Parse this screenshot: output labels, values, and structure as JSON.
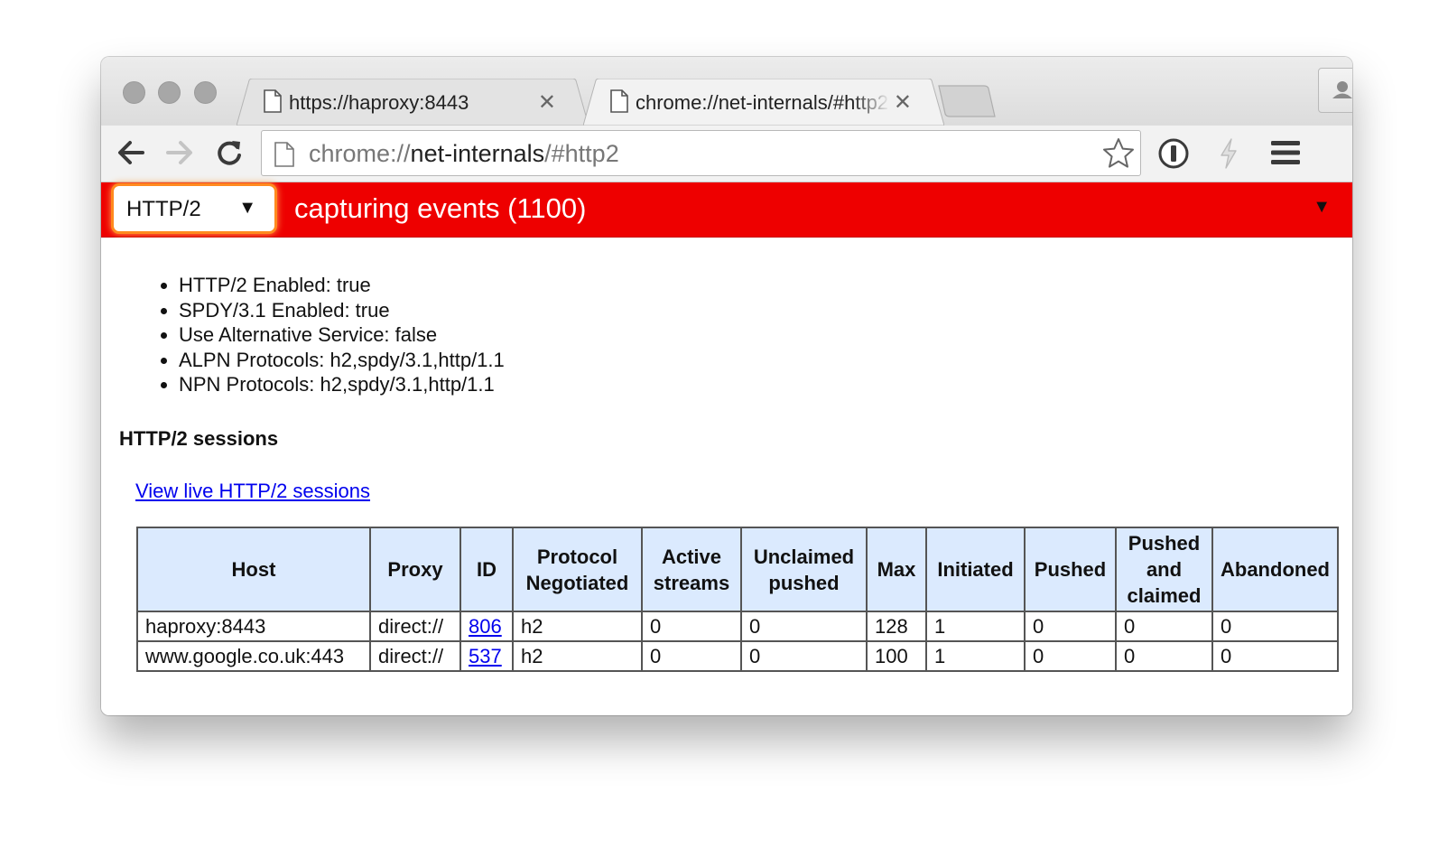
{
  "tabs": [
    {
      "title": "https://haproxy:8443"
    },
    {
      "title": "chrome://net-internals/#http2"
    }
  ],
  "omnibox": {
    "scheme": "chrome://",
    "host": "net-internals",
    "path": "/#http2"
  },
  "toolbar": {
    "view_select": "HTTP/2",
    "capture_status": "capturing events (1100)"
  },
  "info_list": [
    "HTTP/2 Enabled: true",
    "SPDY/3.1 Enabled: true",
    "Use Alternative Service: false",
    "ALPN Protocols: h2,spdy/3.1,http/1.1",
    "NPN Protocols: h2,spdy/3.1,http/1.1"
  ],
  "sessions": {
    "heading": "HTTP/2 sessions",
    "live_link": "View live HTTP/2 sessions",
    "columns": [
      "Host",
      "Proxy",
      "ID",
      "Protocol Negotiated",
      "Active streams",
      "Unclaimed pushed",
      "Max",
      "Initiated",
      "Pushed",
      "Pushed and claimed",
      "Abandoned"
    ],
    "rows": [
      [
        "haproxy:8443",
        "direct://",
        "806",
        "h2",
        "0",
        "0",
        "128",
        "1",
        "0",
        "0",
        "0"
      ],
      [
        "www.google.co.uk:443",
        "direct://",
        "537",
        "h2",
        "0",
        "0",
        "100",
        "1",
        "0",
        "0",
        "0"
      ]
    ]
  },
  "icons": {
    "back": "back-arrow-icon",
    "forward": "forward-arrow-icon",
    "reload": "reload-icon",
    "page": "page-icon",
    "star": "star-icon",
    "extension": "1password-icon",
    "flash": "lightning-icon",
    "menu": "hamburger-menu-icon",
    "profile": "person-icon"
  },
  "colors": {
    "capture_bar": "#ee0000",
    "select_glow": "#ff8a1e",
    "table_header": "#dbeafe",
    "link": "#0000ee"
  }
}
